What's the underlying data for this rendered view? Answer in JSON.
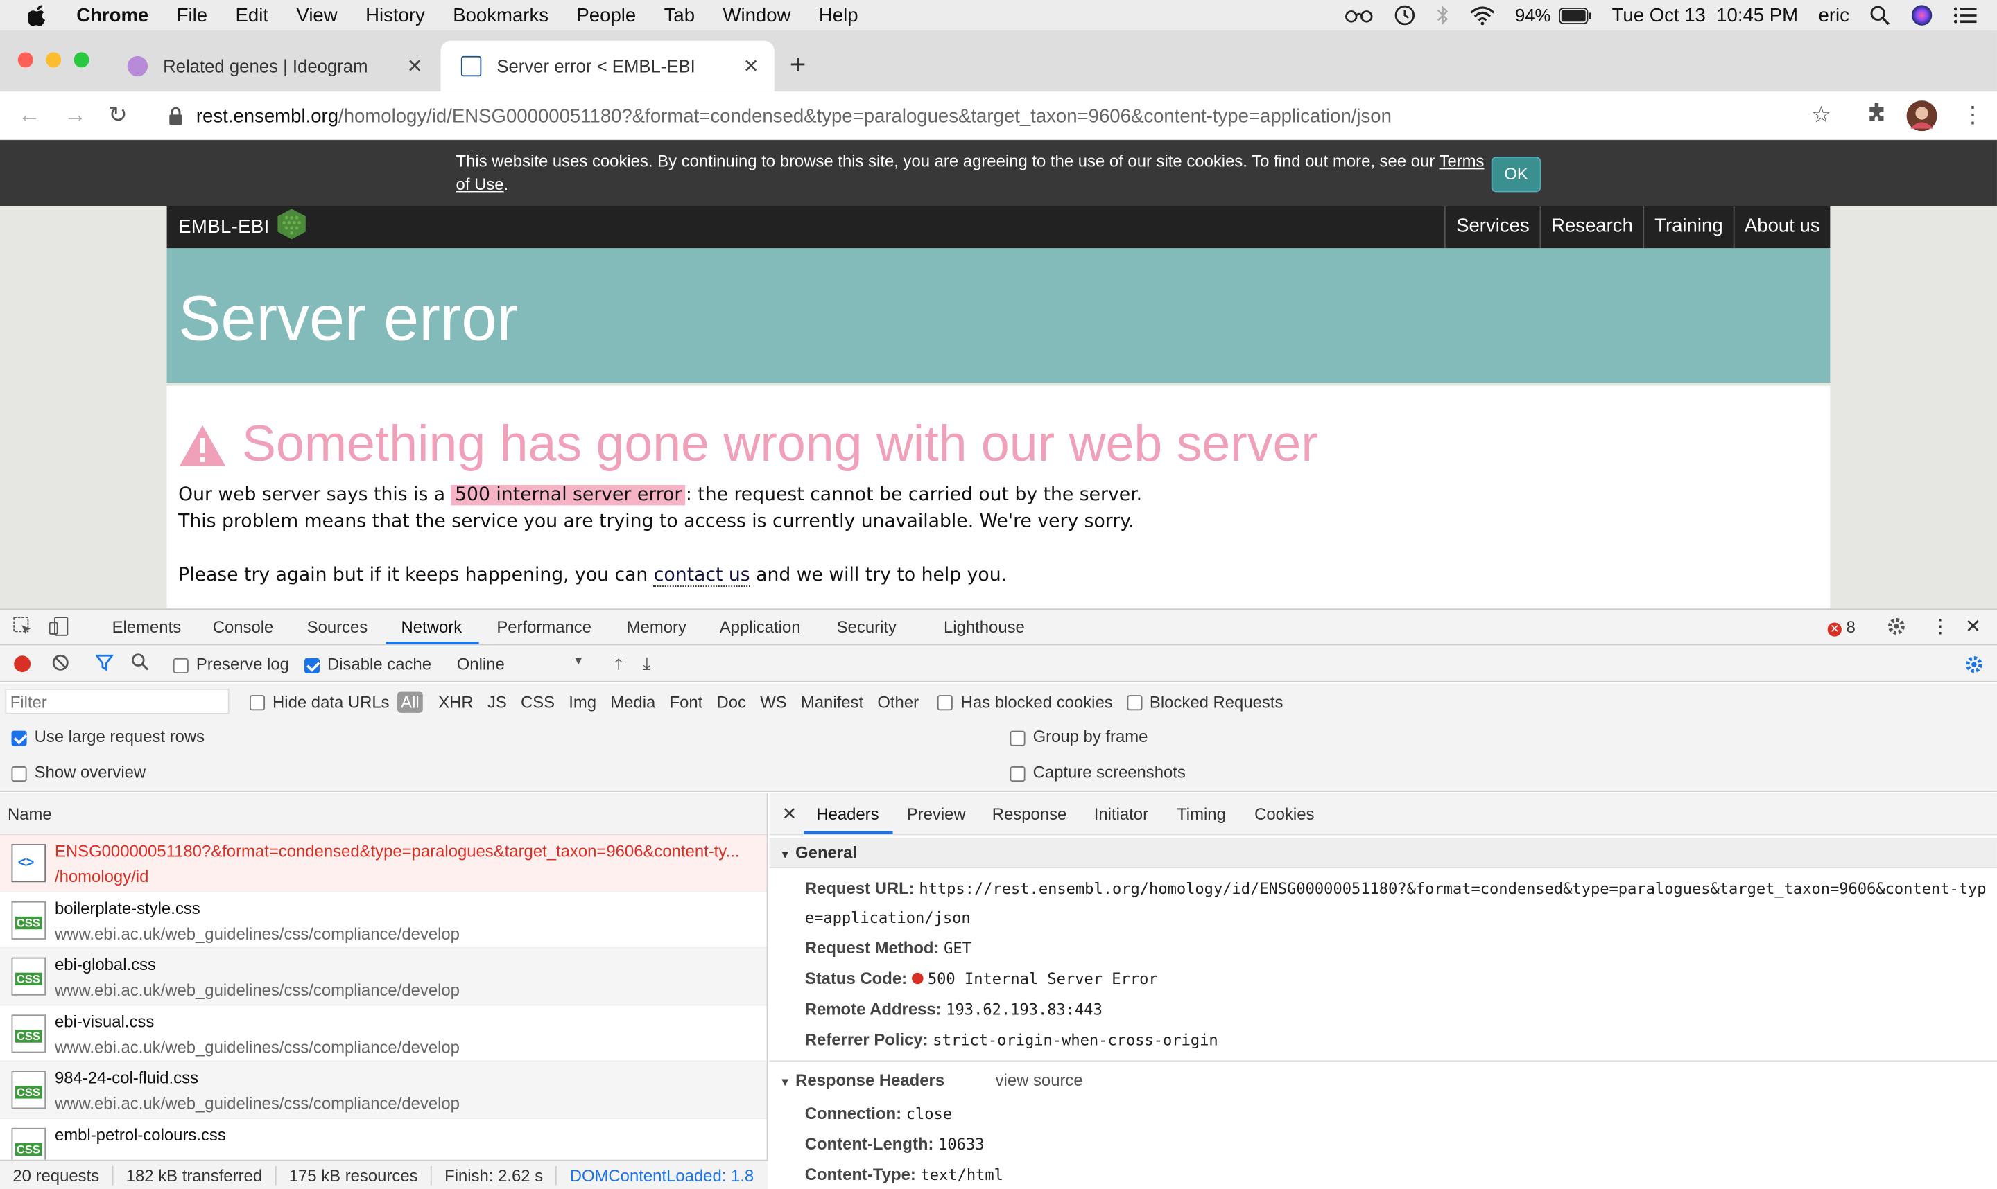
{
  "menubar": {
    "app": "Chrome",
    "items": [
      "File",
      "Edit",
      "View",
      "History",
      "Bookmarks",
      "People",
      "Tab",
      "Window",
      "Help"
    ],
    "battery": "94%",
    "datetime": "Tue Oct 13  10:45 PM",
    "user": "eric"
  },
  "tabs": [
    {
      "title": "Related genes | Ideogram"
    },
    {
      "title": "Server error < EMBL-EBI"
    }
  ],
  "address": {
    "host": "rest.ensembl.org",
    "path": "/homology/id/ENSG00000051180?&format=condensed&type=paralogues&target_taxon=9606&content-type=application/json"
  },
  "cookie": {
    "text": "This website uses cookies. By continuing to browse this site, you are agreeing to the use of our site cookies. To find out more, see our",
    "link": "Terms of Use",
    "end": ".",
    "ok": "OK"
  },
  "site": {
    "logo": "EMBL-EBI",
    "nav": [
      "Services",
      "Research",
      "Training",
      "About us"
    ],
    "title": "Server error",
    "warning": "Something has gone wrong with our web server",
    "p1_pre": "Our web server says this is a ",
    "p1_hl": "500 internal server error",
    "p1_post": ": the request cannot be carried out by the server.",
    "p2": "This problem means that the service you are trying to access is currently unavailable. We're very sorry.",
    "p3_pre": "Please try again but if it keeps happening, you can ",
    "p3_link": "contact us",
    "p3_post": " and we will try to help you."
  },
  "devtools": {
    "tabs": [
      "Elements",
      "Console",
      "Sources",
      "Network",
      "Performance",
      "Memory",
      "Application",
      "Security",
      "Lighthouse"
    ],
    "error_count": "8",
    "preserve_log": "Preserve log",
    "disable_cache": "Disable cache",
    "throttle": "Online",
    "filter_placeholder": "Filter",
    "hide_data_urls": "Hide data URLs",
    "types": [
      "All",
      "XHR",
      "JS",
      "CSS",
      "Img",
      "Media",
      "Font",
      "Doc",
      "WS",
      "Manifest",
      "Other"
    ],
    "has_blocked": "Has blocked cookies",
    "blocked_requests": "Blocked Requests",
    "large_rows": "Use large request rows",
    "show_overview": "Show overview",
    "group_by_frame": "Group by frame",
    "capture_screenshots": "Capture screenshots",
    "name_header": "Name",
    "requests": [
      {
        "name": "ENSG00000051180?&format=condensed&type=paralogues&target_taxon=9606&content-ty...",
        "path": "/homology/id",
        "type": "doc"
      },
      {
        "name": "boilerplate-style.css",
        "path": "www.ebi.ac.uk/web_guidelines/css/compliance/develop",
        "type": "css"
      },
      {
        "name": "ebi-global.css",
        "path": "www.ebi.ac.uk/web_guidelines/css/compliance/develop",
        "type": "css"
      },
      {
        "name": "ebi-visual.css",
        "path": "www.ebi.ac.uk/web_guidelines/css/compliance/develop",
        "type": "css"
      },
      {
        "name": "984-24-col-fluid.css",
        "path": "www.ebi.ac.uk/web_guidelines/css/compliance/develop",
        "type": "css"
      },
      {
        "name": "embl-petrol-colours.css",
        "path": "",
        "type": "css"
      }
    ],
    "status": {
      "requests": "20 requests",
      "transferred": "182 kB transferred",
      "resources": "175 kB resources",
      "finish": "Finish: 2.62 s",
      "dcl": "DOMContentLoaded: 1.8"
    },
    "detail_tabs": [
      "Headers",
      "Preview",
      "Response",
      "Initiator",
      "Timing",
      "Cookies"
    ],
    "general_label": "General",
    "request_url_label": "Request URL:",
    "request_url_1": "https://rest.ensembl.org/homology/id/ENSG00000051180?&format=condensed&type=paralogues&target_taxon=9606&content-typ",
    "request_url_2": "e=application/json",
    "method_label": "Request Method:",
    "method": "GET",
    "status_label": "Status Code:",
    "status_code": "500 Internal Server Error",
    "remote_label": "Remote Address:",
    "remote": "193.62.193.83:443",
    "referrer_label": "Referrer Policy:",
    "referrer": "strict-origin-when-cross-origin",
    "response_headers_label": "Response Headers",
    "view_source": "view source",
    "connection_label": "Connection:",
    "connection": "close",
    "content_length_label": "Content-Length:",
    "content_length": "10633",
    "content_type_label": "Content-Type:",
    "content_type": "text/html"
  }
}
